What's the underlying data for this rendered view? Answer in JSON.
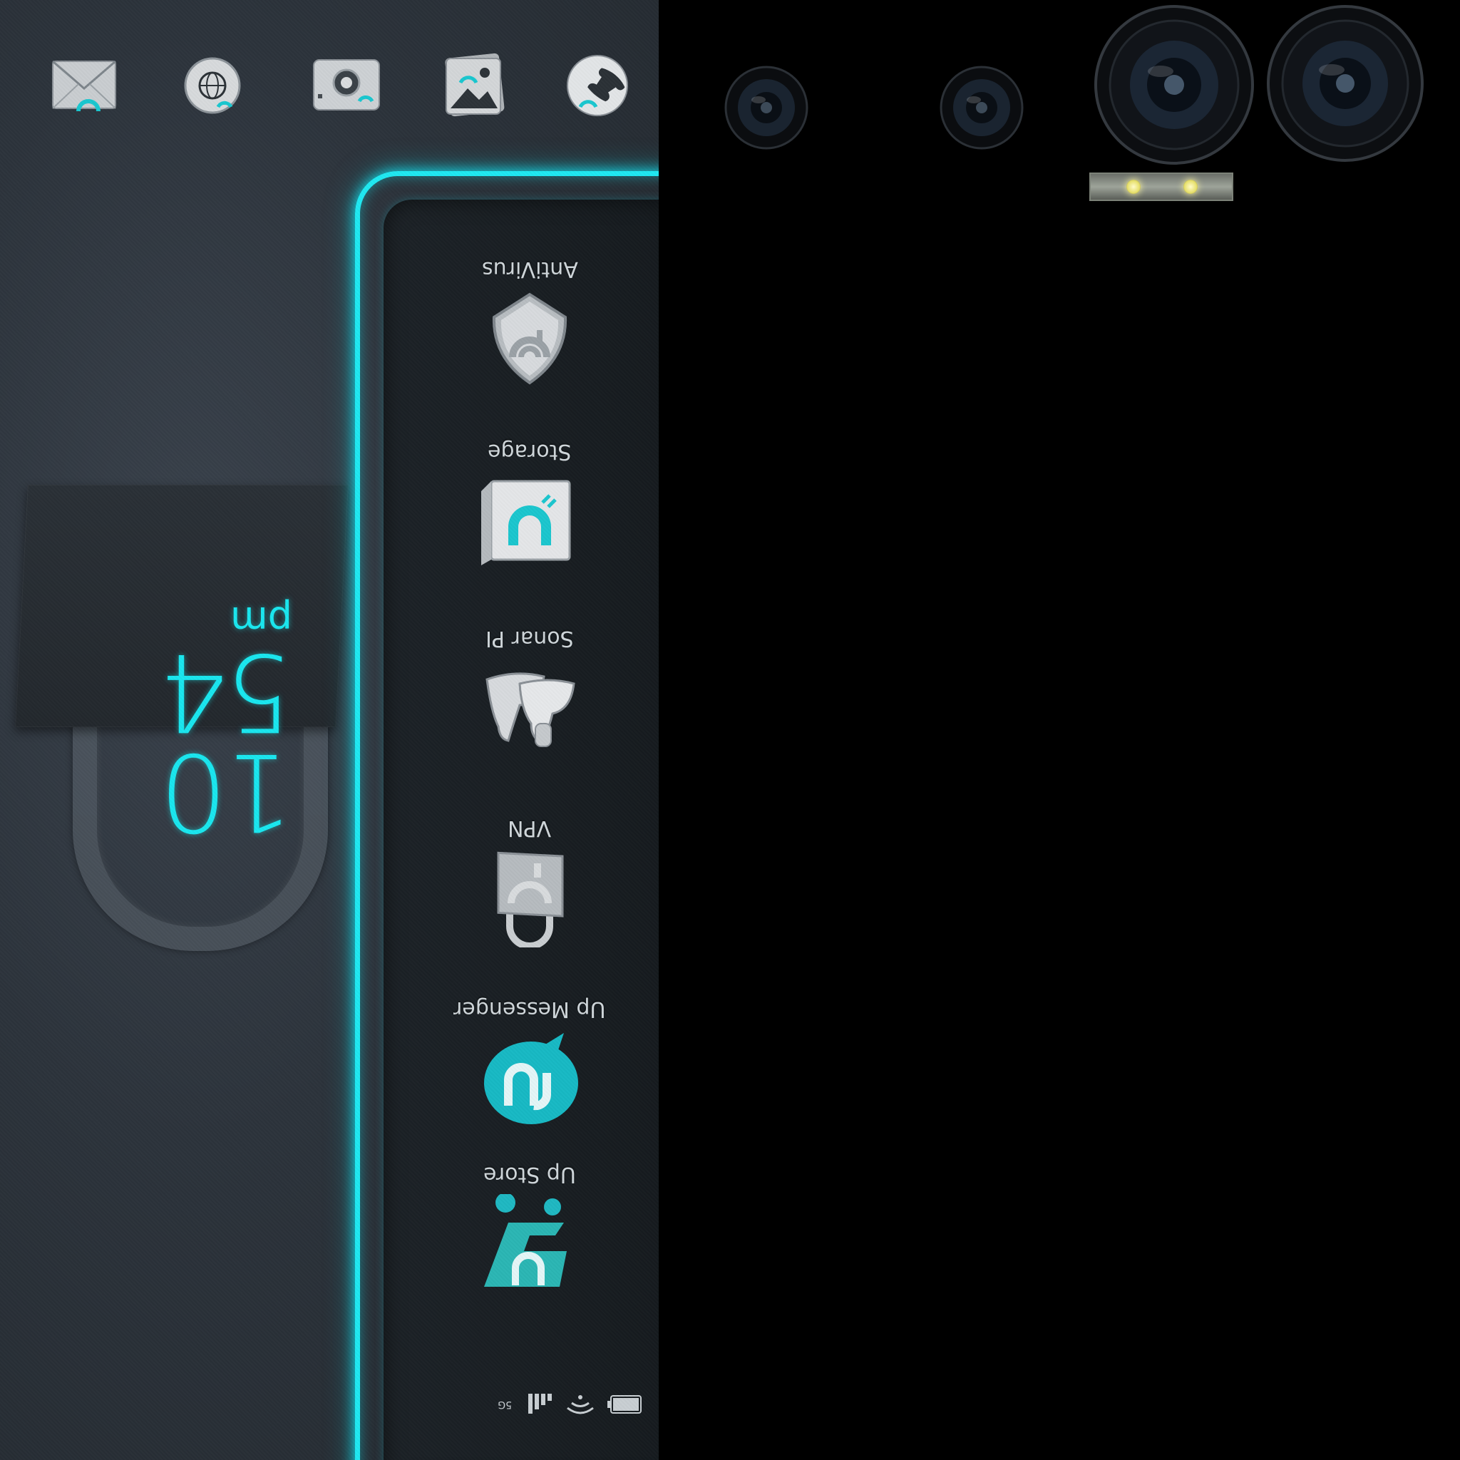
{
  "clock": {
    "hour": "10",
    "minute": "54",
    "ampm": "pm"
  },
  "dock": [
    {
      "name": "mail",
      "icon": "mail-icon"
    },
    {
      "name": "browser",
      "icon": "globe-icon"
    },
    {
      "name": "camera",
      "icon": "camera-icon"
    },
    {
      "name": "gallery",
      "icon": "gallery-icon"
    },
    {
      "name": "phone",
      "icon": "phone-icon"
    }
  ],
  "apps": [
    {
      "label": "AntiVirus",
      "icon": "shield-icon"
    },
    {
      "label": "Storage",
      "icon": "storage-box-icon"
    },
    {
      "label": "Sonar PI",
      "icon": "sonar-icon"
    },
    {
      "label": "VPN",
      "icon": "padlock-icon"
    },
    {
      "label": "Up Messenger",
      "icon": "messenger-icon"
    },
    {
      "label": "Up Store",
      "icon": "store-icon"
    }
  ],
  "status": {
    "network": "5G",
    "icons": [
      "signal-icon",
      "wifi-icon",
      "battery-icon"
    ]
  },
  "colors": {
    "accent": "#1fe9f2",
    "background": "#2c333b",
    "panel": "#171c20",
    "hardware": "#000000"
  }
}
